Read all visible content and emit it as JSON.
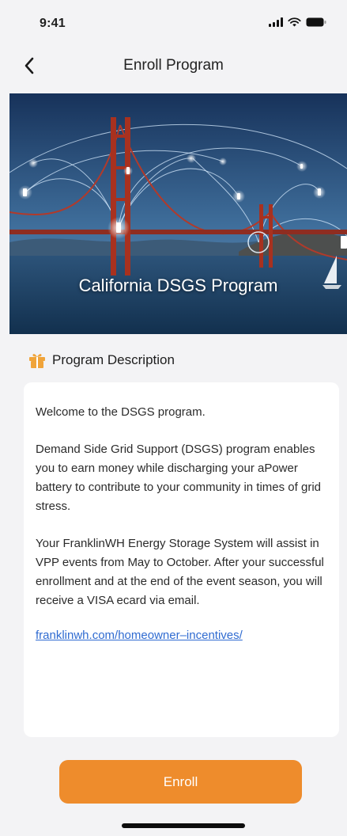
{
  "status_bar": {
    "time": "9:41"
  },
  "nav": {
    "title": "Enroll Program",
    "back_icon": "chevron-left-icon"
  },
  "hero": {
    "title": "California DSGS Program"
  },
  "section": {
    "title": "Program Description",
    "icon": "gift-icon",
    "icon_color": "#f0a43a"
  },
  "description": {
    "paragraphs": [
      "Welcome to the DSGS program.",
      "Demand Side Grid Support (DSGS) program enables you to earn money while discharging your aPower battery to contribute to your community in times of grid stress.",
      "Your FranklinWH Energy Storage System will assist in VPP events from May to October. After your successful enrollment and at the end of the event season, you will receive a VISA ecard via email."
    ],
    "link": "franklinwh.com/homeowner–incentives/"
  },
  "enroll_button": {
    "label": "Enroll",
    "color": "#ee8c2c"
  },
  "colors": {
    "background": "#f3f3f5",
    "link": "#2f6bd1"
  }
}
